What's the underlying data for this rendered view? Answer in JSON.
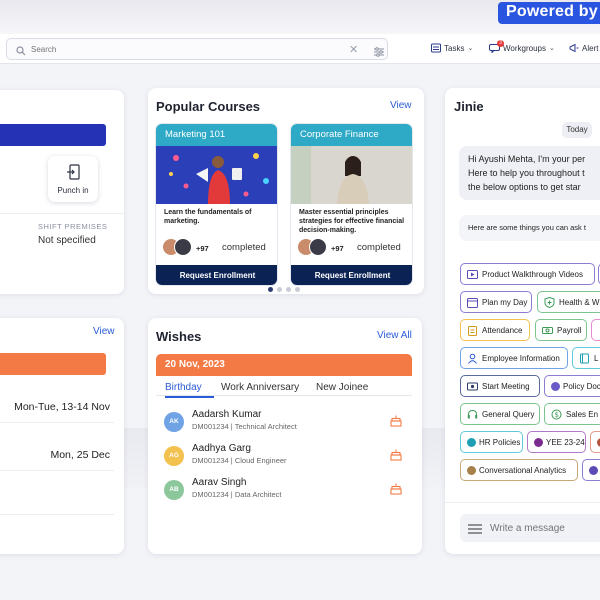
{
  "banner": {
    "powered_by": "Powered by C"
  },
  "topbar": {
    "search_placeholder": "Search",
    "tasks_label": "Tasks",
    "workgroups_label": "Workgroups",
    "workgroups_badge": "3",
    "alerts_label": "Alert"
  },
  "attendance_card": {
    "punch_in_label": "Punch in",
    "shift_premises_label": "SHIFT PREMISES",
    "shift_premises_value": "Not specified"
  },
  "courses_card": {
    "title": "Popular  Courses",
    "view_label": "View",
    "courses": [
      {
        "name": "Marketing 101",
        "description": "Learn the fundamentals of marketing.",
        "enrolled_count": "+97",
        "status": "completed",
        "button": "Request Enrollment"
      },
      {
        "name": "Corporate Finance",
        "description": "Master essential principles strategies for effective financial decision-making.",
        "enrolled_count": "+97",
        "status": "completed",
        "button": "Request Enrollment"
      }
    ]
  },
  "holidays_card": {
    "view_label": "View",
    "rows": [
      "Mon-Tue, 13-14 Nov",
      "Mon, 25 Dec"
    ]
  },
  "wishes_card": {
    "title": "Wishes",
    "view_all_label": "View All",
    "date": "20 Nov, 2023",
    "tabs": [
      "Birthday",
      "Work Anniversary",
      "New Joinee"
    ],
    "people": [
      {
        "initials": "AK",
        "name": "Aadarsh Kumar",
        "id": "DM001234",
        "role": "Technical Architect",
        "color": "#6fa3e6"
      },
      {
        "initials": "AG",
        "name": "Aadhya Garg",
        "id": "DM001234",
        "role": "Cloud Engineer",
        "color": "#f2c14e"
      },
      {
        "initials": "AB",
        "name": "Aarav Singh",
        "id": "DM001234",
        "role": "Data Architect",
        "color": "#8cc79b"
      }
    ]
  },
  "jinie": {
    "title": "Jinie",
    "date_pill": "Today",
    "greeting_lines": [
      "Hi Ayushi Mehta, I'm your per",
      "Here to help you throughout t",
      "the below options to get star"
    ],
    "prompt": "Here are some things you can ask t",
    "chips": [
      "Product Walkthrough Videos",
      "Plan my Day",
      "Health & W",
      "Attendance",
      "Payroll",
      "Employee Information",
      "L",
      "Start Meeting",
      "Policy Docu",
      "General Query",
      "Sales En",
      "HR Policies",
      "YEE 23-24",
      "Conversational Analytics",
      "N"
    ],
    "message_placeholder": "Write a message"
  }
}
